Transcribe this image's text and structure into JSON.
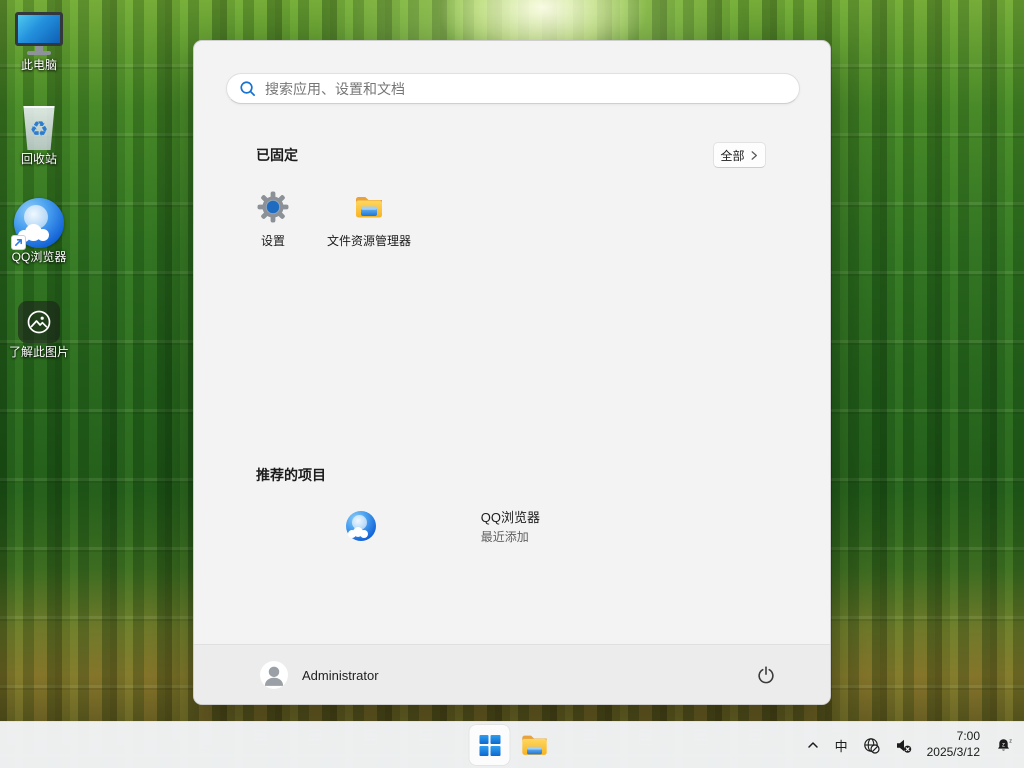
{
  "desktop": {
    "icons": [
      {
        "label": "此电脑",
        "icon": "this-pc-icon"
      },
      {
        "label": "回收站",
        "icon": "recycle-bin-icon"
      },
      {
        "label": "QQ浏览器",
        "icon": "qq-browser-icon"
      },
      {
        "label": "了解此图片",
        "icon": "learn-about-picture-icon"
      }
    ],
    "recycle_glyph": "♻"
  },
  "start_menu": {
    "search": {
      "placeholder": "搜索应用、设置和文档"
    },
    "pinned": {
      "title": "已固定",
      "all_button_label": "全部",
      "items": [
        {
          "label": "设置",
          "icon": "settings-gear-icon"
        },
        {
          "label": "文件资源管理器",
          "icon": "file-explorer-folder-icon"
        }
      ]
    },
    "recommended": {
      "title": "推荐的项目",
      "items": [
        {
          "label": "QQ浏览器",
          "sublabel": "最近添加",
          "icon": "qq-browser-icon"
        }
      ]
    },
    "footer": {
      "user": "Administrator"
    }
  },
  "taskbar": {
    "tray": {
      "ime_label": "中",
      "time": "7:00",
      "date": "2025/3/12",
      "bell_z": "z"
    }
  },
  "colors": {
    "accent_blue": "#1673d2",
    "menu_bg": "#f3f3f3",
    "footer_bg": "#ececec",
    "taskbar_bg": "#f3f5f7",
    "folder_yellow": "#f9b826"
  }
}
